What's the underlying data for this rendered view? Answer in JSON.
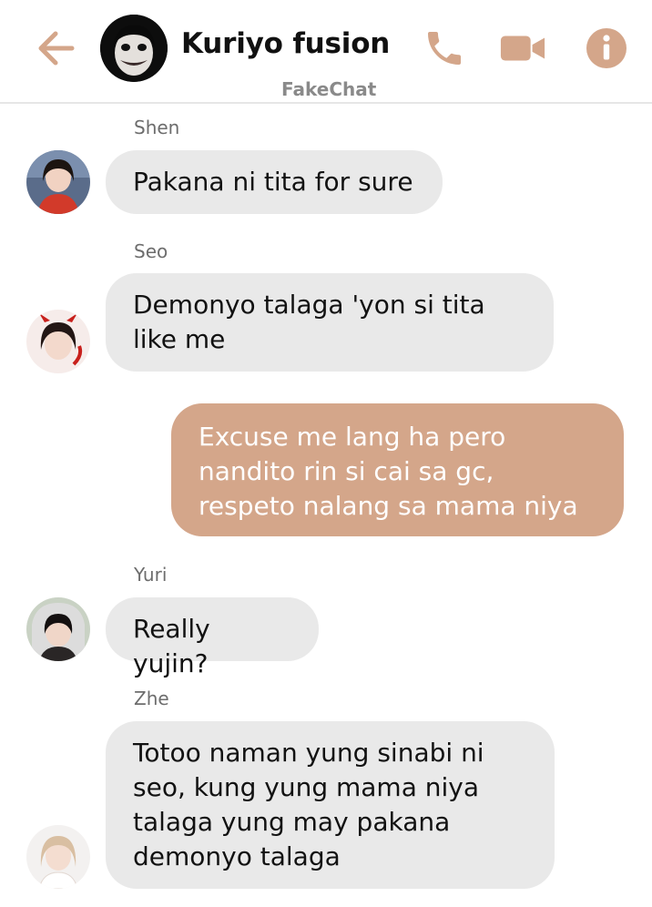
{
  "colors": {
    "accent": "#d4a68a",
    "incoming_bubble": "#e9e9e9",
    "outgoing_text": "#ffffff"
  },
  "header": {
    "title": "Kuriyo fusion",
    "subtitle": "FakeChat",
    "icons": [
      "back-arrow-icon",
      "phone-icon",
      "video-camera-icon",
      "info-icon"
    ]
  },
  "messages": [
    {
      "sender": "Shen",
      "direction": "incoming",
      "text": "Pakana ni tita for sure"
    },
    {
      "sender": "Seo",
      "direction": "incoming",
      "text": "Demonyo talaga 'yon si tita\nlike me"
    },
    {
      "sender": "",
      "direction": "outgoing",
      "text": "Excuse me lang ha pero\nnandito rin si cai sa gc,\nrespeto nalang sa mama niya"
    },
    {
      "sender": "Yuri",
      "direction": "incoming",
      "text": "Really yujin?"
    },
    {
      "sender": "Zhe",
      "direction": "incoming",
      "text": "Totoo naman yung sinabi ni\nseo, kung yung mama niya\ntalaga yung may pakana\ndemonyo talaga"
    }
  ]
}
